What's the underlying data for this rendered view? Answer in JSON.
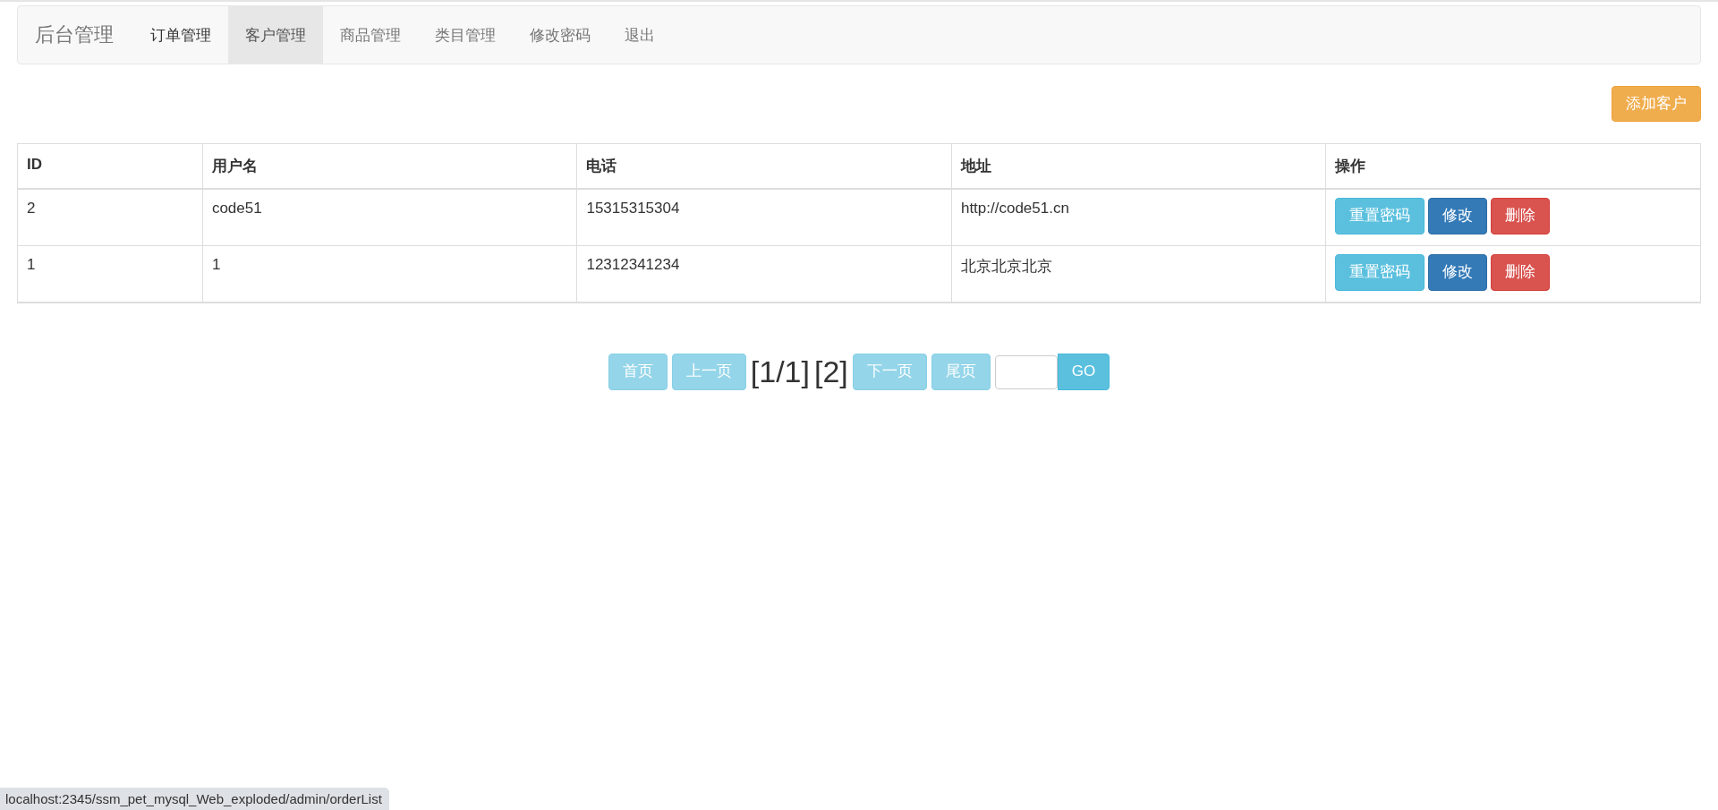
{
  "navbar": {
    "brand": "后台管理",
    "items": [
      {
        "label": "订单管理",
        "selected": false,
        "hovered": true
      },
      {
        "label": "客户管理",
        "selected": true,
        "hovered": false
      },
      {
        "label": "商品管理",
        "selected": false,
        "hovered": false
      },
      {
        "label": "类目管理",
        "selected": false,
        "hovered": false
      },
      {
        "label": "修改密码",
        "selected": false,
        "hovered": false
      },
      {
        "label": "退出",
        "selected": false,
        "hovered": false
      }
    ]
  },
  "add_button": "添加客户",
  "table": {
    "columns": [
      "ID",
      "用户名",
      "电话",
      "地址",
      "操作"
    ],
    "rows": [
      {
        "cells": [
          "2",
          "code51",
          "15315315304",
          "http://code51.cn"
        ],
        "actions": [
          {
            "label": "重置密码",
            "kind": "info"
          },
          {
            "label": "修改",
            "kind": "primary"
          },
          {
            "label": "删除",
            "kind": "danger"
          }
        ]
      },
      {
        "cells": [
          "1",
          "1",
          "12312341234",
          "北京北京北京"
        ],
        "actions": [
          {
            "label": "重置密码",
            "kind": "info"
          },
          {
            "label": "修改",
            "kind": "primary"
          },
          {
            "label": "删除",
            "kind": "danger"
          }
        ]
      }
    ]
  },
  "pagination": {
    "before": [
      {
        "label": "首页",
        "disabled": true
      },
      {
        "label": "上一页",
        "disabled": true
      }
    ],
    "page_info": "[1/1]",
    "total": "[2]",
    "after": [
      {
        "label": "下一页",
        "disabled": true
      },
      {
        "label": "尾页",
        "disabled": true
      }
    ],
    "go": {
      "label": "GO",
      "disabled": false
    }
  },
  "status_bar": "localhost:2345/ssm_pet_mysql_Web_exploded/admin/orderList"
}
